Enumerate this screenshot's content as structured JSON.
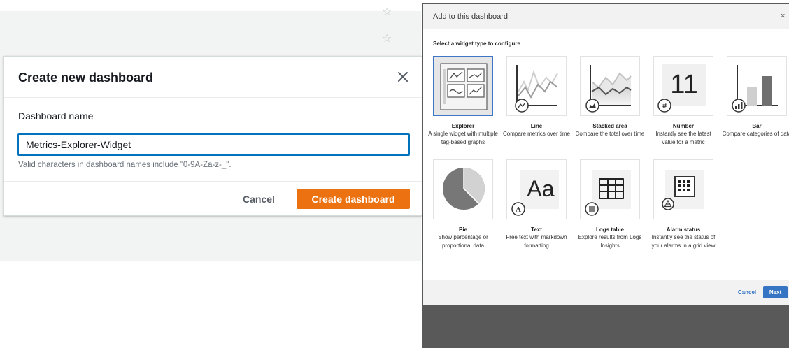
{
  "create_dialog": {
    "title": "Create new dashboard",
    "name_label": "Dashboard name",
    "name_value": "Metrics-Explorer-Widget",
    "hint": "Valid characters in dashboard names include \"0-9A-Za-z-_\".",
    "cancel_label": "Cancel",
    "create_label": "Create dashboard"
  },
  "widget_dialog": {
    "title": "Add to this dashboard",
    "close_label": "×",
    "subtitle": "Select a widget type to configure",
    "number_glyph": "11",
    "text_glyph": "Aa",
    "widgets": [
      {
        "title": "Explorer",
        "desc": "A single widget with multiple tag-based graphs",
        "selected": true
      },
      {
        "title": "Line",
        "desc": "Compare metrics over time"
      },
      {
        "title": "Stacked area",
        "desc": "Compare the total over time"
      },
      {
        "title": "Number",
        "desc": "Instantly see the latest value for a metric"
      },
      {
        "title": "Bar",
        "desc": "Compare categories of data"
      },
      {
        "title": "Pie",
        "desc": "Show percentage or proportional data"
      },
      {
        "title": "Text",
        "desc": "Free text with markdown formatting"
      },
      {
        "title": "Logs table",
        "desc": "Explore results from Logs Insights"
      },
      {
        "title": "Alarm status",
        "desc": "Instantly see the status of your alarms in a grid view"
      }
    ],
    "cancel_label": "Cancel",
    "next_label": "Next"
  },
  "colors": {
    "primary_orange": "#ec7211",
    "focus_blue": "#0073bb",
    "link_blue": "#3575c3",
    "backdrop_gray": "#595959"
  }
}
